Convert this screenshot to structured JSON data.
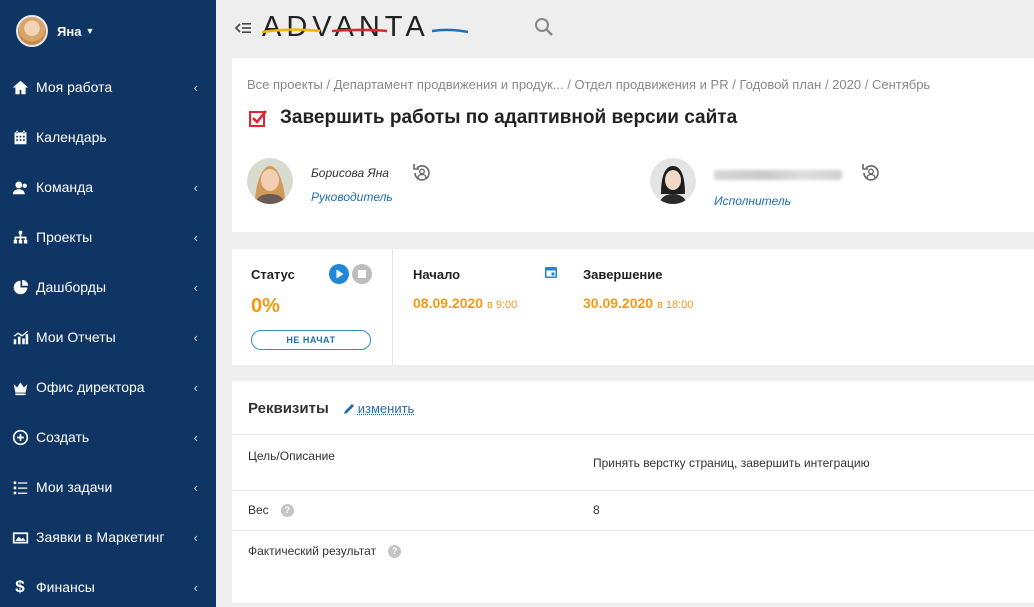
{
  "user": {
    "name": "Яна"
  },
  "sidebar": {
    "items": [
      {
        "label": "Моя работа",
        "icon": "home-icon",
        "has_submenu": true
      },
      {
        "label": "Календарь",
        "icon": "calendar-icon",
        "has_submenu": false
      },
      {
        "label": "Команда",
        "icon": "team-icon",
        "has_submenu": true
      },
      {
        "label": "Проекты",
        "icon": "sitemap-icon",
        "has_submenu": true
      },
      {
        "label": "Дашборды",
        "icon": "pie-chart-icon",
        "has_submenu": true
      },
      {
        "label": "Мои Отчеты",
        "icon": "bar-chart-icon",
        "has_submenu": true
      },
      {
        "label": "Офис директора",
        "icon": "crown-icon",
        "has_submenu": true
      },
      {
        "label": "Создать",
        "icon": "plus-circle-icon",
        "has_submenu": true
      },
      {
        "label": "Мои задачи",
        "icon": "list-icon",
        "has_submenu": true
      },
      {
        "label": "Заявки в Маркетинг",
        "icon": "image-icon",
        "has_submenu": true
      },
      {
        "label": "Финансы",
        "icon": "dollar-icon",
        "has_submenu": true
      }
    ]
  },
  "header": {
    "logo": "ADVANTA"
  },
  "breadcrumb": [
    "Все проекты",
    "Департамент продвижения и продук...",
    "Отдел продвижения и PR",
    "Годовой план",
    "2020",
    "Сентябрь"
  ],
  "task": {
    "title": "Завершить работы по адаптивной версии сайта",
    "manager": {
      "name": "Борисова Яна",
      "role": "Руководитель"
    },
    "executor": {
      "name": "",
      "role": "Исполнитель"
    }
  },
  "status": {
    "label": "Статус",
    "percent": "0%",
    "badge": "НЕ НАЧАТ",
    "start_label": "Начало",
    "start_date": "08.09.2020",
    "start_time": "в 9:00",
    "end_label": "Завершение",
    "end_date": "30.09.2020",
    "end_time": "в 18:00"
  },
  "requisites": {
    "title": "Реквизиты",
    "edit_label": "изменить",
    "rows": [
      {
        "key": "Цель/Описание",
        "value": "Принять верстку страниц, завершить интеграцию",
        "help": false
      },
      {
        "key": "Вес",
        "value": "8",
        "help": true
      },
      {
        "key": "Фактический результат",
        "value": "",
        "help": true
      }
    ]
  },
  "colors": {
    "sidebar": "#0f3564",
    "accent_orange": "#f39a12",
    "link_blue": "#1f6fb5"
  }
}
